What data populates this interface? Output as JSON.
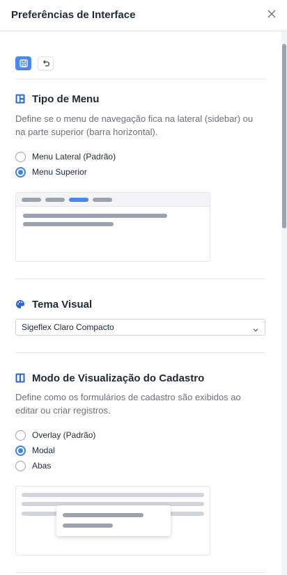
{
  "dialog": {
    "title": "Preferências de Interface",
    "close_icon": "close-icon"
  },
  "toolbar": {
    "save_icon": "save-icon",
    "undo_icon": "undo-icon",
    "accent_color": "#4a87f0"
  },
  "menu_type": {
    "title": "Tipo de Menu",
    "icon": "layout-icon",
    "description": "Define se o menu de navegação fica na lateral (sidebar) ou na parte superior (barra horizontal).",
    "options": [
      {
        "label": "Menu Lateral (Padrão)",
        "checked": false
      },
      {
        "label": "Menu Superior",
        "checked": true
      }
    ]
  },
  "theme": {
    "title": "Tema Visual",
    "icon": "palette-icon",
    "selected": "Sigeflex Claro Compacto"
  },
  "register_mode": {
    "title": "Modo de Visualização do Cadastro",
    "icon": "columns-icon",
    "description": "Define como os formulários de cadastro são exibidos ao editar ou criar registros.",
    "options": [
      {
        "label": "Overlay (Padrão)",
        "checked": false
      },
      {
        "label": "Modal",
        "checked": true
      },
      {
        "label": "Abas",
        "checked": false
      }
    ]
  },
  "colors": {
    "primary": "#3b82f6",
    "muted_text": "#6b7280",
    "border": "#e5e7eb"
  }
}
